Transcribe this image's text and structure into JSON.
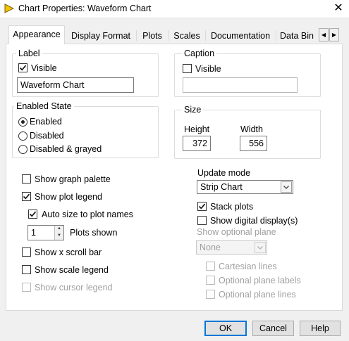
{
  "window": {
    "title": "Chart Properties: Waveform Chart",
    "icon": "labview-triangle-icon",
    "close_label": "✕"
  },
  "tabs": [
    {
      "label": "Appearance",
      "active": true
    },
    {
      "label": "Display Format"
    },
    {
      "label": "Plots"
    },
    {
      "label": "Scales"
    },
    {
      "label": "Documentation"
    },
    {
      "label": "Data Bin"
    }
  ],
  "tab_scroll": {
    "left": "◀",
    "right": "▶"
  },
  "label_group": {
    "title": "Label",
    "visible_label": "Visible",
    "visible_checked": true,
    "value": "Waveform Chart"
  },
  "caption_group": {
    "title": "Caption",
    "visible_label": "Visible",
    "visible_checked": false,
    "value": ""
  },
  "enabled_state": {
    "title": "Enabled State",
    "options": [
      "Enabled",
      "Disabled",
      "Disabled & grayed"
    ],
    "selected": "Enabled"
  },
  "size": {
    "title": "Size",
    "height_label": "Height",
    "height_value": "372",
    "width_label": "Width",
    "width_value": "556"
  },
  "options": {
    "show_graph_palette": {
      "label": "Show graph palette",
      "checked": false
    },
    "show_plot_legend": {
      "label": "Show plot legend",
      "checked": true
    },
    "auto_size": {
      "label": "Auto size to plot names",
      "checked": true
    },
    "plots_shown": {
      "label": "Plots shown",
      "value": "1"
    },
    "show_x_scroll_bar": {
      "label": "Show x scroll bar",
      "checked": false
    },
    "show_scale_legend": {
      "label": "Show scale legend",
      "checked": false
    },
    "show_cursor_legend": {
      "label": "Show cursor legend",
      "checked": false,
      "disabled": true
    }
  },
  "update": {
    "title": "Update mode",
    "mode": "Strip Chart",
    "stack_plots": {
      "label": "Stack plots",
      "checked": true
    },
    "show_digital_display": {
      "label": "Show digital display(s)",
      "checked": false
    },
    "optional_plane_label": "Show optional plane",
    "optional_plane_value": "None",
    "cartesian_lines": {
      "label": "Cartesian lines",
      "checked": false
    },
    "optional_plane_labels": {
      "label": "Optional plane labels",
      "checked": false
    },
    "optional_plane_lines": {
      "label": "Optional plane lines",
      "checked": false
    }
  },
  "buttons": {
    "ok": "OK",
    "cancel": "Cancel",
    "help": "Help"
  },
  "colors": {
    "icon_yellow": "#f5c400",
    "panel_bg": "#ffffff",
    "dialog_bg": "#f0f0f0"
  }
}
